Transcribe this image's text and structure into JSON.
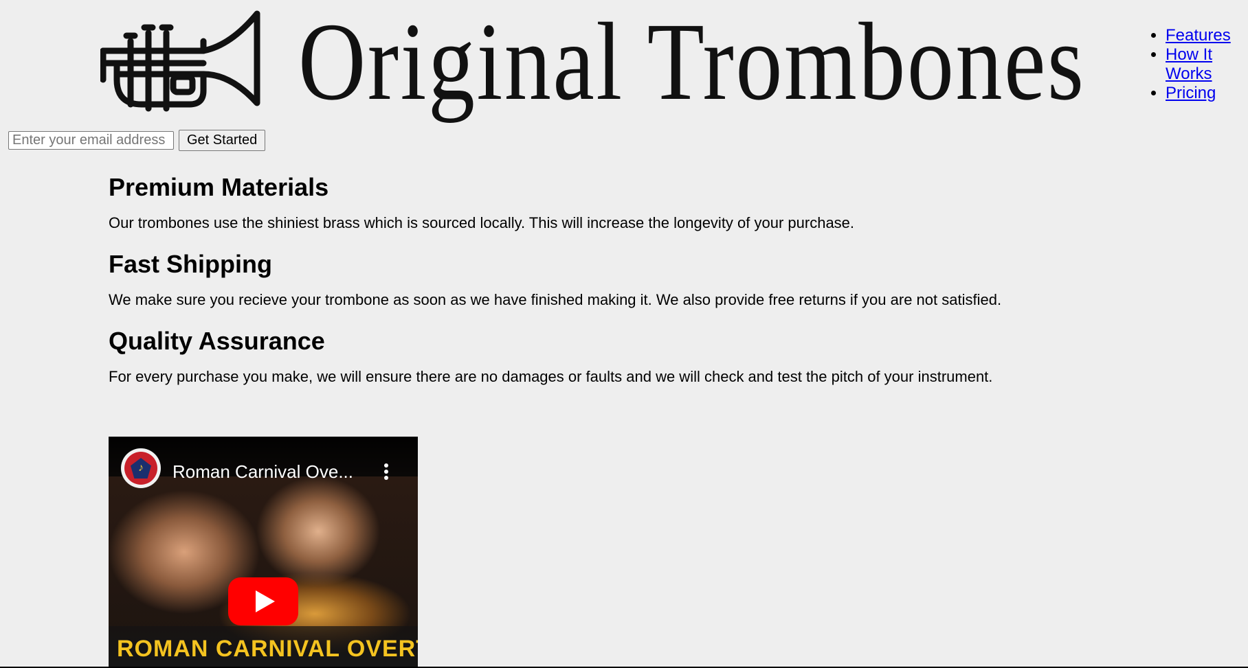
{
  "header": {
    "logo_text": "Original Trombones",
    "logo_icon": "trumpet-icon"
  },
  "nav": {
    "items": [
      {
        "label": "Features"
      },
      {
        "label": "How It Works"
      },
      {
        "label": "Pricing"
      }
    ]
  },
  "signup": {
    "email_placeholder": "Enter your email address",
    "email_value": "",
    "submit_label": "Get Started"
  },
  "features": [
    {
      "title": "Premium Materials",
      "description": "Our trombones use the shiniest brass which is sourced locally. This will increase the longevity of your purchase."
    },
    {
      "title": "Fast Shipping",
      "description": "We make sure you recieve your trombone as soon as we have finished making it. We also provide free returns if you are not satisfied."
    },
    {
      "title": "Quality Assurance",
      "description": "For every purchase you make, we will ensure there are no damages or faults and we will check and test the pitch of your instrument."
    }
  ],
  "video": {
    "title": "Roman Carnival Ove...",
    "banner_text": "ROMAN CARNIVAL OVERT",
    "colors": {
      "play_button": "#ff0000",
      "banner_text": "#f4c320"
    }
  },
  "colors": {
    "background": "#eeeeee",
    "link": "#0000ee"
  }
}
